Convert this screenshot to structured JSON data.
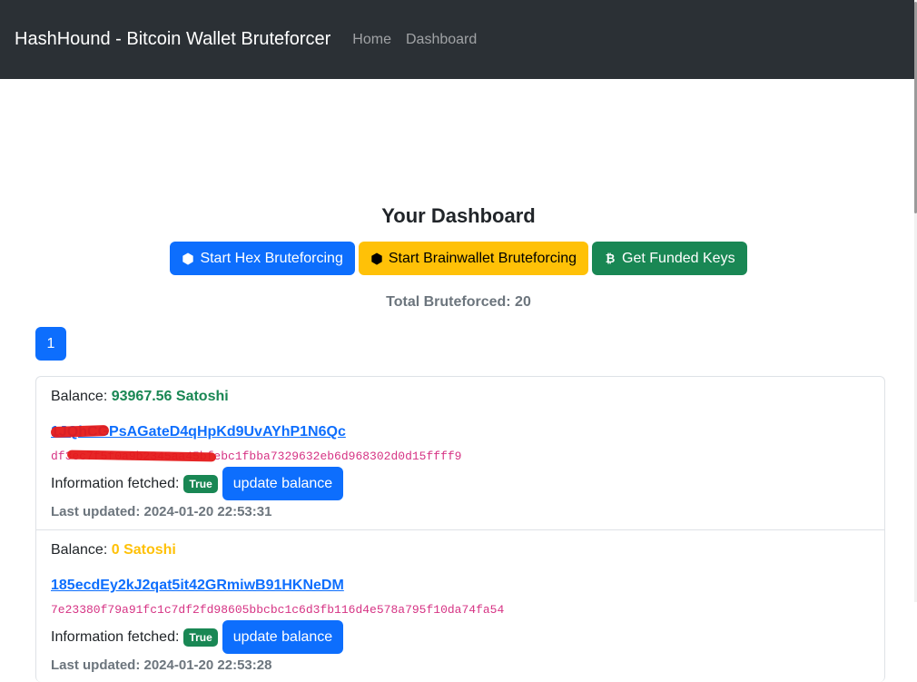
{
  "navbar": {
    "brand": "HashHound - Bitcoin Wallet Bruteforcer",
    "links": [
      "Home",
      "Dashboard"
    ]
  },
  "dashboard": {
    "title": "Your Dashboard",
    "buttons": [
      {
        "label": "Start Hex Bruteforcing",
        "icon": "hexagon-outline-icon"
      },
      {
        "label": "Start Brainwallet Bruteforcing",
        "icon": "hexagon-filled-icon"
      },
      {
        "label": "Get Funded Keys",
        "icon": "bitcoin-icon"
      }
    ],
    "total": "Total Bruteforced: 20",
    "pagination": [
      "1"
    ]
  },
  "wallets": [
    {
      "balance_label": "Balance:",
      "balance": "93967.56 Satoshi",
      "balance_color": "#198754",
      "address": "1JQhCGPsAGateD4qHpKd9UvAYhP1N6Qc",
      "key": "df3ec7f5f0a9b2345aa45bfebc1fbba7329632eb6d968302d0d15ffff9",
      "info_label": "Information fetched:",
      "fetched": "True",
      "update_label": "update balance",
      "last_updated": "Last updated: 2024-01-20 22:53:31"
    },
    {
      "balance_label": "Balance:",
      "balance": "0 Satoshi",
      "balance_color": "#ffc107",
      "address": "185ecdEy2kJ2qat5it42GRmiwB91HKNeDM",
      "key": "7e23380f79a91fc1c7df2fd98605bbcbc1c6d3fb116d4e578a795f10da74fa54",
      "info_label": "Information fetched:",
      "fetched": "True",
      "update_label": "update balance",
      "last_updated": "Last updated: 2024-01-20 22:53:28"
    }
  ]
}
